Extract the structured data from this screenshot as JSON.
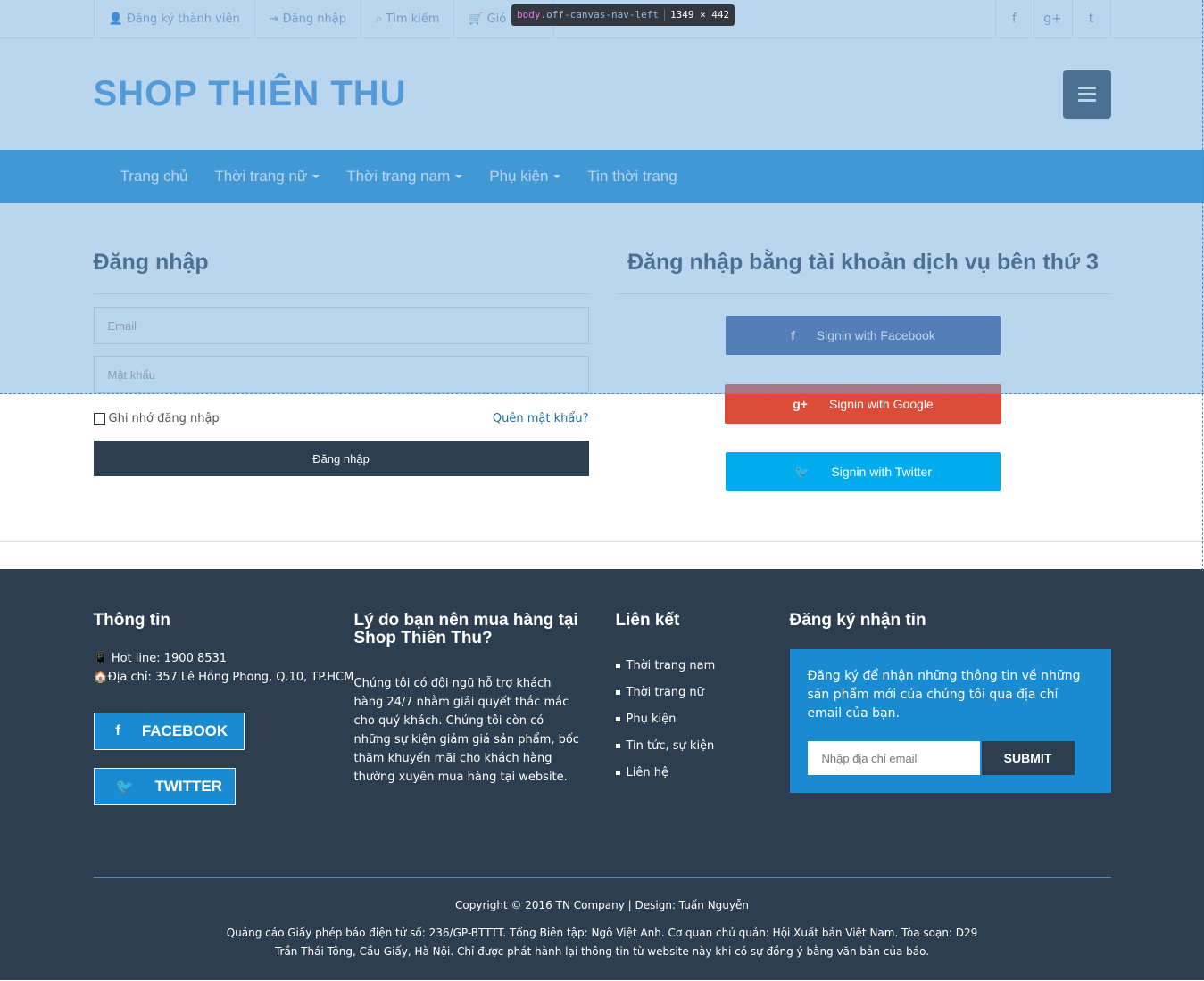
{
  "devtools": {
    "tag": "body",
    "cls": ".off-canvas-nav-left",
    "dims": "1349 × 442"
  },
  "topbar": {
    "links": [
      {
        "icon": "user-icon",
        "glyph": "👤",
        "label": "Đăng ký thành viên"
      },
      {
        "icon": "sign-in-icon",
        "glyph": "⇥",
        "label": "Đăng nhập"
      },
      {
        "icon": "search-icon",
        "glyph": "⌕",
        "label": "Tìm kiếm"
      },
      {
        "icon": "cart-icon",
        "glyph": "🛒",
        "label": "Giỏ hàng"
      }
    ],
    "social": [
      "f",
      "g+",
      "t"
    ]
  },
  "header": {
    "logo": "SHOP THIÊN THU"
  },
  "nav": {
    "items": [
      {
        "label": "Trang chủ",
        "dropdown": false
      },
      {
        "label": "Thời trang nữ",
        "dropdown": true
      },
      {
        "label": "Thời trang nam",
        "dropdown": true
      },
      {
        "label": "Phụ kiện",
        "dropdown": true
      },
      {
        "label": "Tin thời trang",
        "dropdown": false
      }
    ]
  },
  "login": {
    "title": "Đăng nhập",
    "email_placeholder": "Email",
    "password_placeholder": "Mật khẩu",
    "remember": "Ghi nhớ đăng nhập",
    "forgot": "Quên mật khẩu?",
    "submit": "Đăng nhập"
  },
  "social_login": {
    "title": "Đăng nhập bằng tài khoản dịch vụ bên thứ 3",
    "facebook": "Signin with Facebook",
    "google": "Signin with Google",
    "twitter": "Signin with Twitter"
  },
  "footer": {
    "info": {
      "title": "Thông tin",
      "hotline": "Hot line: 1900 8531",
      "address": "Địa chỉ: 357 Lê Hồng Phong, Q.10, TP.HCM",
      "facebook": "FACEBOOK",
      "twitter": "TWITTER"
    },
    "why": {
      "title": "Lý do bạn nên mua hàng tại Shop Thiên Thu?",
      "text": "Chúng tôi có đội ngũ hỗ trợ khách hàng 24/7 nhằm giải quyết thắc mắc cho quý khách. Chúng tôi còn có những sự kiện giảm giá sản phẩm, bốc thăm khuyến mãi cho khách hàng thường xuyên mua hàng tại website."
    },
    "links": {
      "title": "Liên kết",
      "items": [
        "Thời trang nam",
        "Thời trang nữ",
        "Phụ kiện",
        "Tin tức, sự kiện",
        "Liên hệ"
      ]
    },
    "newsletter": {
      "title": "Đăng ký nhận tin",
      "text": "Đăng ký để nhận những thông tin về những sản phẩm mới của chúng tôi qua địa chỉ email của bạn.",
      "placeholder": "Nhập địa chỉ email",
      "submit": "SUBMIT"
    }
  },
  "copyright": {
    "line1": "Copyright © 2016 TN Company | Design: Tuấn Nguyễn",
    "line2": "Quảng cáo Giấy phép báo điện tử số: 236/GP-BTTTT. Tổng Biên tập: Ngô Việt Anh. Cơ quan chủ quản: Hội Xuất bản Việt Nam. Tòa soạn: D29",
    "line3": "Trần Thái Tông, Cầu Giấy, Hà Nội. Chỉ được phát hành lại thông tin từ website này khi có sự đồng ý bằng văn bản của báo."
  }
}
